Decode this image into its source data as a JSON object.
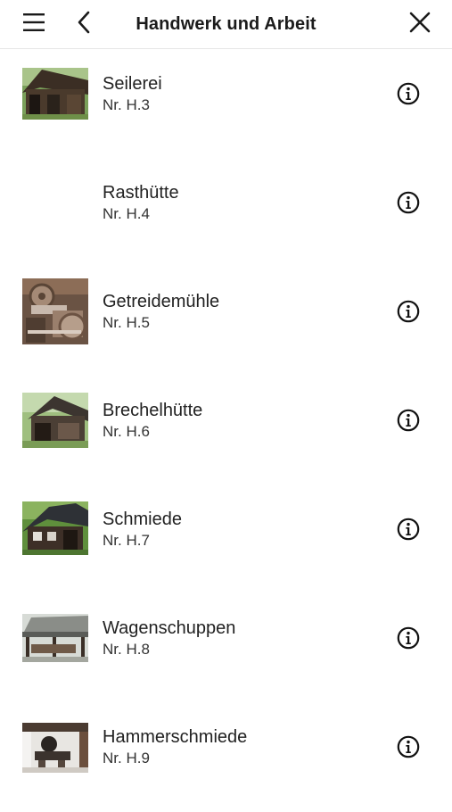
{
  "header": {
    "title": "Handwerk und Arbeit",
    "menu_icon": "hamburger-menu-icon",
    "back_icon": "chevron-left-icon",
    "close_icon": "close-icon"
  },
  "items": [
    {
      "title": "Seilerei",
      "number": "Nr. H.3",
      "thumbnail": "wooden-barn-photo",
      "info_icon": "info-icon"
    },
    {
      "title": "Rasthütte",
      "number": "Nr. H.4",
      "thumbnail": "",
      "info_icon": "info-icon"
    },
    {
      "title": "Getreidemühle",
      "number": "Nr. H.5",
      "thumbnail": "mill-gears-photo",
      "info_icon": "info-icon"
    },
    {
      "title": "Brechelhütte",
      "number": "Nr. H.6",
      "thumbnail": "hut-photo",
      "info_icon": "info-icon"
    },
    {
      "title": "Schmiede",
      "number": "Nr. H.7",
      "thumbnail": "forge-house-photo",
      "info_icon": "info-icon"
    },
    {
      "title": "Wagenschuppen",
      "number": "Nr. H.8",
      "thumbnail": "wagon-shed-photo",
      "info_icon": "info-icon"
    },
    {
      "title": "Hammerschmiede",
      "number": "Nr. H.9",
      "thumbnail": "hammer-forge-photo",
      "info_icon": "info-icon"
    }
  ],
  "colors": {
    "text": "#1a1a1a",
    "divider": "#e6e6e6",
    "background": "#ffffff"
  }
}
